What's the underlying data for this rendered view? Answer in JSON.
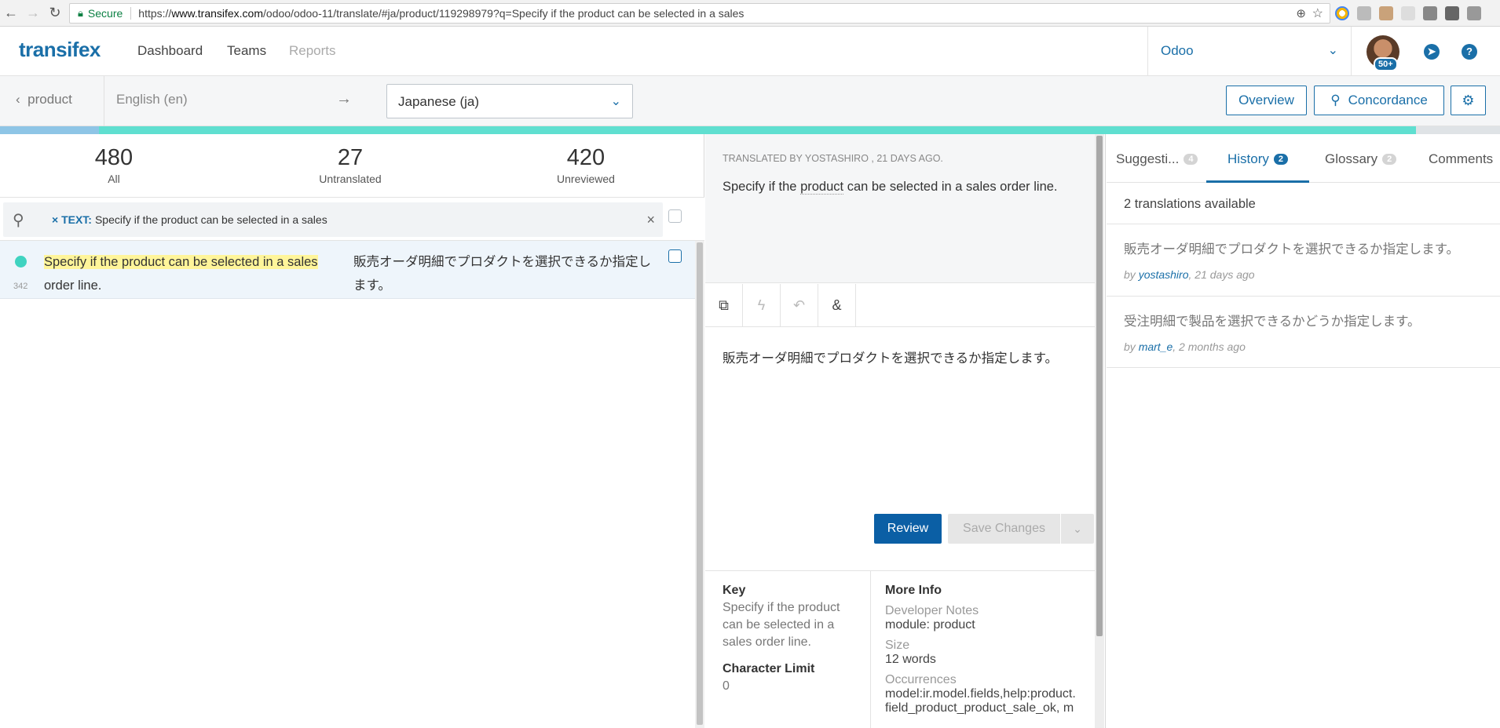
{
  "browser": {
    "secure_label": "Secure",
    "url_prefix": "https://",
    "url_host": "www.transifex.com",
    "url_path": "/odoo/odoo-11/translate/#ja/product/119298979?q=Specify if the product can be selected in a sales"
  },
  "header": {
    "logo": "transifex",
    "nav": [
      "Dashboard",
      "Teams",
      "Reports"
    ],
    "org": "Odoo",
    "notifications": "50+"
  },
  "subheader": {
    "back_label": "product",
    "source_language": "English (en)",
    "arrow": "→",
    "target_language": "Japanese (ja)",
    "overview_button": "Overview",
    "concordance_button": "Concordance"
  },
  "stats": [
    {
      "count": "480",
      "label": "All"
    },
    {
      "count": "27",
      "label": "Untranslated"
    },
    {
      "count": "420",
      "label": "Unreviewed"
    }
  ],
  "progress": {
    "reviewed_fraction": 0.066,
    "translated_fraction": 0.944
  },
  "search": {
    "chip_key": "TEXT:",
    "chip_value": "Specify if the product can be selected in a sales"
  },
  "string_row": {
    "index": "342",
    "source_highlight": "Specify if the product can be selected in a sales",
    "source_rest": " order line.",
    "translation": "販売オーダ明細でプロダクトを選択できるか指定します。"
  },
  "editor": {
    "translated_by_prefix": "Translated by ",
    "translator": "yostashiro",
    "translated_by_suffix": " , 21 days ago.",
    "source_pre": "Specify if the ",
    "source_term": "product",
    "source_post": " can be selected in a sales order line.",
    "translation": "販売オーダ明細でプロダクトを選択できるか指定します。",
    "review_button": "Review",
    "save_button": "Save Changes"
  },
  "details": {
    "key_label": "Key",
    "key_value": "Specify if the product can be selected in a sales order line.",
    "char_limit_label": "Character Limit",
    "char_limit_value": "0",
    "more_info_label": "More Info",
    "dev_notes_label": "Developer Notes",
    "dev_notes_value": "module: product",
    "size_label": "Size",
    "size_value": "12 words",
    "occurrences_label": "Occurrences",
    "occurrences_value": "model:ir.model.fields,help:product.",
    "occurrences_value_2": "field_product_product_sale_ok, m"
  },
  "tabs": [
    {
      "label": "Suggesti...",
      "count": "4"
    },
    {
      "label": "History",
      "count": "2"
    },
    {
      "label": "Glossary",
      "count": "2"
    },
    {
      "label": "Comments"
    }
  ],
  "history": {
    "available": "2 translations available",
    "items": [
      {
        "text": "販売オーダ明細でプロダクトを選択できるか指定します。",
        "by": "by ",
        "user": "yostashiro",
        "when": ", 21 days ago"
      },
      {
        "text": "受注明細で製品を選択できるかどうか指定します。",
        "by": "by ",
        "user": "mart_e",
        "when": ", 2 months ago"
      }
    ]
  },
  "colors": {
    "accent": "#1a6fa8",
    "translated": "#3fd3c0",
    "highlight": "#fff59a"
  }
}
